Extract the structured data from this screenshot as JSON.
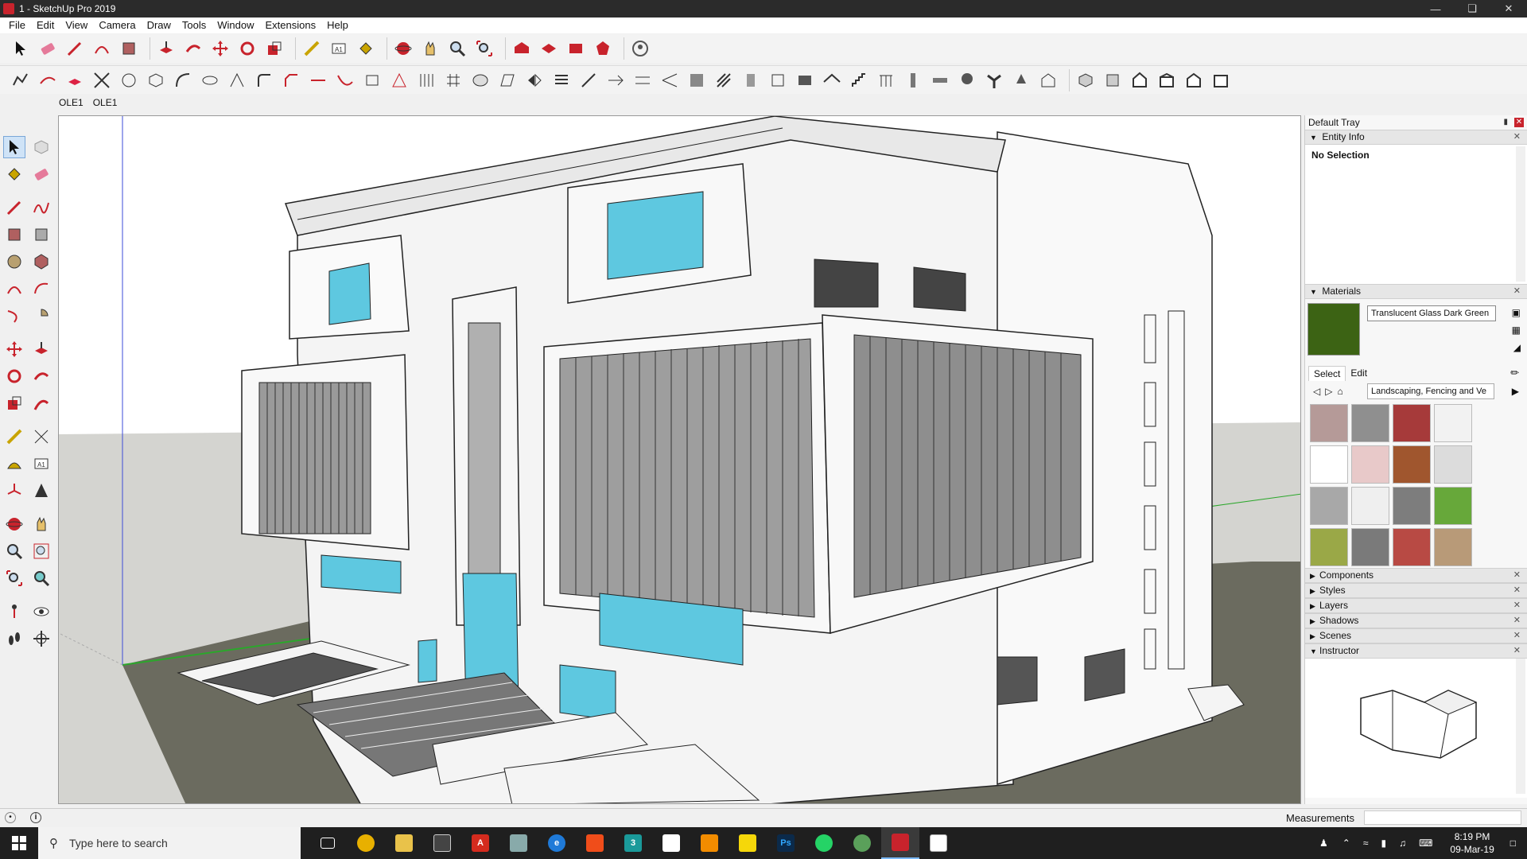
{
  "window": {
    "title": "1 - SketchUp Pro 2019"
  },
  "menu": [
    "File",
    "Edit",
    "View",
    "Camera",
    "Draw",
    "Tools",
    "Window",
    "Extensions",
    "Help"
  ],
  "tabs": [
    "OLE1",
    "OLE1"
  ],
  "tray": {
    "title": "Default Tray",
    "entity_info": {
      "header": "Entity Info",
      "selection": "No Selection"
    },
    "materials": {
      "header": "Materials",
      "name": "Translucent Glass Dark Green",
      "swatch_color": "#3c6314",
      "tab_select": "Select",
      "tab_edit": "Edit",
      "collection": "Landscaping, Fencing and Ve",
      "swatches": [
        "#b59a98",
        "#8f8f8f",
        "#a63a3a",
        "#f2f2f2",
        "#ffffff",
        "#e8c9c9",
        "#a0562e",
        "#dcdcdc",
        "#a8a8a8",
        "#efefef",
        "#7d7d7d",
        "#67a83a",
        "#9aa847",
        "#7a7a7a",
        "#b84a44",
        "#b89a78"
      ]
    },
    "collapsed_panels": [
      "Components",
      "Styles",
      "Layers",
      "Shadows",
      "Scenes"
    ],
    "instructor": {
      "header": "Instructor"
    }
  },
  "status": {
    "measurements_label": "Measurements",
    "measurements_value": ""
  },
  "taskbar": {
    "search_placeholder": "Type here to search",
    "time": "8:19 PM",
    "date": "09-Mar-19"
  },
  "colors": {
    "glass": "#7fd8ea",
    "ground": "#6b6b5f",
    "sky": "#ffffff",
    "accent_red": "#c8232c"
  }
}
